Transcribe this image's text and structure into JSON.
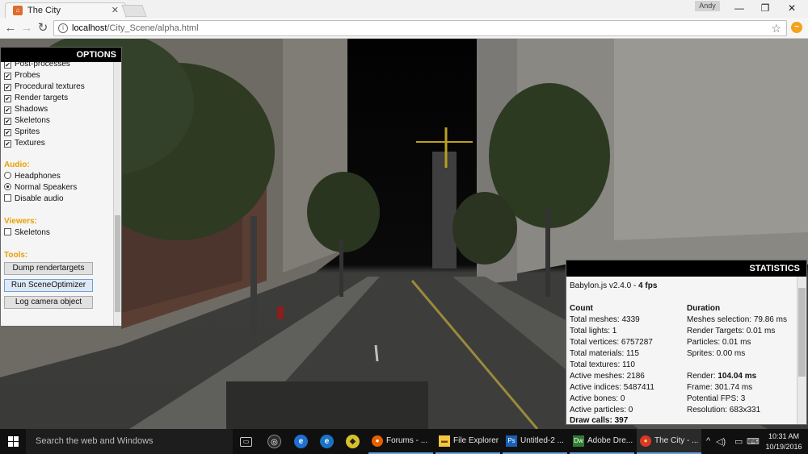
{
  "browser": {
    "tab_title": "The City",
    "tab_close": "✕",
    "profile": "Andy",
    "url_host": "localhost",
    "url_path": "/City_Scene/alpha.html",
    "window_controls": {
      "minimize": "—",
      "maximize": "❐",
      "close": "✕"
    },
    "nav": {
      "back": "←",
      "forward": "→",
      "reload": "↻"
    },
    "info_glyph": "i",
    "bookmark_star": "☆",
    "extension_glyph": "−"
  },
  "options": {
    "header": "OPTIONS",
    "checkboxes": [
      {
        "label": "Post-processes",
        "checked": true
      },
      {
        "label": "Probes",
        "checked": true
      },
      {
        "label": "Procedural textures",
        "checked": true
      },
      {
        "label": "Render targets",
        "checked": true
      },
      {
        "label": "Shadows",
        "checked": true
      },
      {
        "label": "Skeletons",
        "checked": true
      },
      {
        "label": "Sprites",
        "checked": true
      },
      {
        "label": "Textures",
        "checked": true
      }
    ],
    "audio_title": "Audio:",
    "audio": [
      {
        "label": "Headphones",
        "type": "radio",
        "checked": false
      },
      {
        "label": "Normal Speakers",
        "type": "radio",
        "checked": true
      },
      {
        "label": "Disable audio",
        "type": "checkbox",
        "checked": false
      }
    ],
    "viewers_title": "Viewers:",
    "viewers": [
      {
        "label": "Skeletons",
        "checked": false
      }
    ],
    "tools_title": "Tools:",
    "tools": [
      "Dump rendertargets",
      "Run SceneOptimizer",
      "Log camera object"
    ]
  },
  "statistics": {
    "header": "STATISTICS",
    "version": "Babylon.js v2.4.0 - ",
    "fps": "4 fps",
    "count_title": "Count",
    "duration_title": "Duration",
    "count": [
      "Total meshes: 4339",
      "Total lights: 1",
      "Total vertices: 6757287",
      "Total materials: 115",
      "Total textures: 110",
      "Active meshes: 2186",
      "Active indices: 5487411",
      "Active bones: 0",
      "Active particles: 0"
    ],
    "draw_calls": "Draw calls: 397",
    "duration": [
      "Meshes selection: 79.86 ms",
      "Render Targets: 0.01 ms",
      "Particles: 0.01 ms",
      "Sprites: 0.00 ms"
    ],
    "render_label": "Render: ",
    "render_value": "104.04 ms",
    "frame": "Frame: 301.74 ms",
    "potential_fps": "Potential FPS: 3",
    "resolution": "Resolution: 683x331"
  },
  "taskbar": {
    "search_placeholder": "Search the web and Windows",
    "apps": [
      {
        "label": "Forums - ...",
        "icon": "firefox-icon",
        "color": "#e66000",
        "glyph": "●"
      },
      {
        "label": "File Explorer",
        "icon": "folder-icon",
        "color": "#f5c542",
        "glyph": "▬"
      },
      {
        "label": "Untitled-2 ...",
        "icon": "photoshop-icon",
        "color": "#1a5fb4",
        "glyph": "Ps"
      },
      {
        "label": "Adobe Dre...",
        "icon": "dreamweaver-icon",
        "color": "#2e7d32",
        "glyph": "Dw"
      },
      {
        "label": "The City - ...",
        "icon": "chrome-icon",
        "color": "#d9392a",
        "glyph": "●"
      }
    ],
    "pinned_glyphs": {
      "task_view": "▭",
      "cortana": "◎",
      "edge": "e",
      "ie": "e",
      "misc": "◆"
    },
    "tray": {
      "chevron": "^",
      "speaker": "◁)",
      "network": "▭",
      "keyboard": "⌨"
    },
    "time": "10:31 AM",
    "date": "10/19/2016"
  }
}
